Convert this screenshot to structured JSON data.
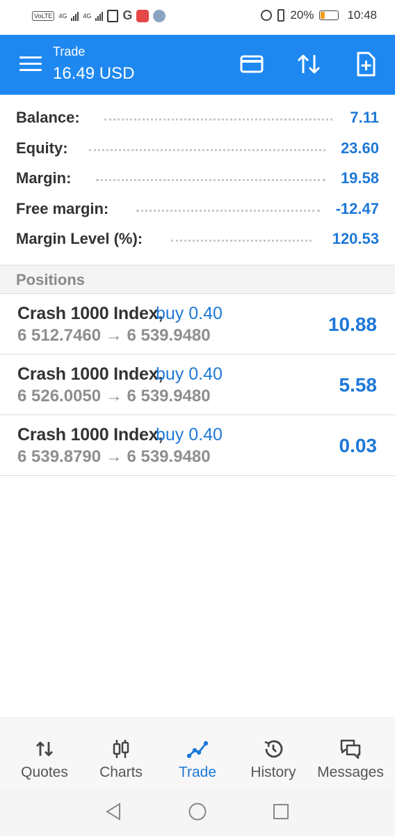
{
  "status_bar": {
    "volte": "VoLTE",
    "network_1": "4G",
    "network_2": "4G",
    "battery_percent": "20%",
    "time": "10:48"
  },
  "app_bar": {
    "title": "Trade",
    "subtitle": "16.49 USD",
    "actions": [
      "card-icon",
      "sort-arrows-icon",
      "new-order-icon"
    ]
  },
  "account": [
    {
      "label": "Balance:",
      "value": "7.11"
    },
    {
      "label": "Equity:",
      "value": "23.60"
    },
    {
      "label": "Margin:",
      "value": "19.58"
    },
    {
      "label": "Free margin:",
      "value": "-12.47"
    },
    {
      "label": "Margin Level (%):",
      "value": "120.53"
    }
  ],
  "positions_header": "Positions",
  "positions": [
    {
      "symbol": "Crash 1000 Index,",
      "side": "buy 0.40",
      "open": "6 512.7460",
      "arrow": "→",
      "current": "6 539.9480",
      "profit": "10.88"
    },
    {
      "symbol": "Crash 1000 Index,",
      "side": "buy 0.40",
      "open": "6 526.0050",
      "arrow": "→",
      "current": "6 539.9480",
      "profit": "5.58"
    },
    {
      "symbol": "Crash 1000 Index,",
      "side": "buy 0.40",
      "open": "6 539.8790",
      "arrow": "→",
      "current": "6 539.9480",
      "profit": "0.03"
    }
  ],
  "bottom_nav": {
    "tabs": [
      {
        "label": "Quotes",
        "icon": "quotes-icon"
      },
      {
        "label": "Charts",
        "icon": "charts-icon"
      },
      {
        "label": "Trade",
        "icon": "trade-icon",
        "active": true
      },
      {
        "label": "History",
        "icon": "history-icon"
      },
      {
        "label": "Messages",
        "icon": "messages-icon"
      }
    ]
  },
  "colors": {
    "accent": "#1e88f0",
    "value_blue": "#1e78d8",
    "muted_text": "#8e8e8e"
  }
}
